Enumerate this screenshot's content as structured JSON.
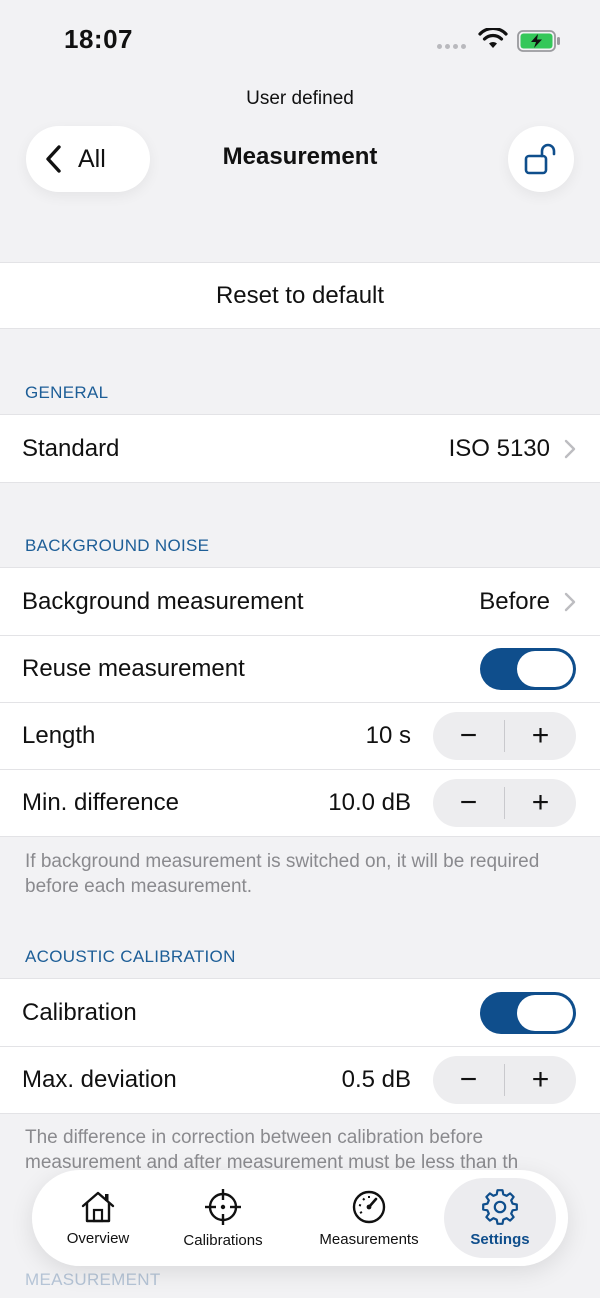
{
  "status_bar": {
    "time": "18:07"
  },
  "nav": {
    "subtitle": "User defined",
    "title": "Measurement",
    "back_label": "All"
  },
  "reset": {
    "label": "Reset to default"
  },
  "general": {
    "header": "GENERAL",
    "standard": {
      "label": "Standard",
      "value": "ISO 5130"
    }
  },
  "background_noise": {
    "header": "BACKGROUND NOISE",
    "background_measurement": {
      "label": "Background measurement",
      "value": "Before"
    },
    "reuse": {
      "label": "Reuse measurement",
      "on": true
    },
    "length": {
      "label": "Length",
      "value": "10 s"
    },
    "min_difference": {
      "label": "Min. difference",
      "value": "10.0 dB"
    },
    "footer": "If background measurement is switched on, it will be required before each measurement."
  },
  "acoustic_calibration": {
    "header": "ACOUSTIC CALIBRATION",
    "calibration": {
      "label": "Calibration",
      "on": true
    },
    "max_deviation": {
      "label": "Max. deviation",
      "value": "0.5 dB"
    },
    "footer": "The difference in correction between calibration before measurement and after measurement must be less than th"
  },
  "measurement_header": "MEASUREMENT",
  "stepper": {
    "minus": "−",
    "plus": "+"
  },
  "tab_bar": {
    "overview": "Overview",
    "calibrations": "Calibrations",
    "measurements": "Measurements",
    "settings": "Settings"
  },
  "colors": {
    "accent": "#0f4e8c",
    "section": "#1d5e97",
    "background": "#f2f2f4"
  }
}
